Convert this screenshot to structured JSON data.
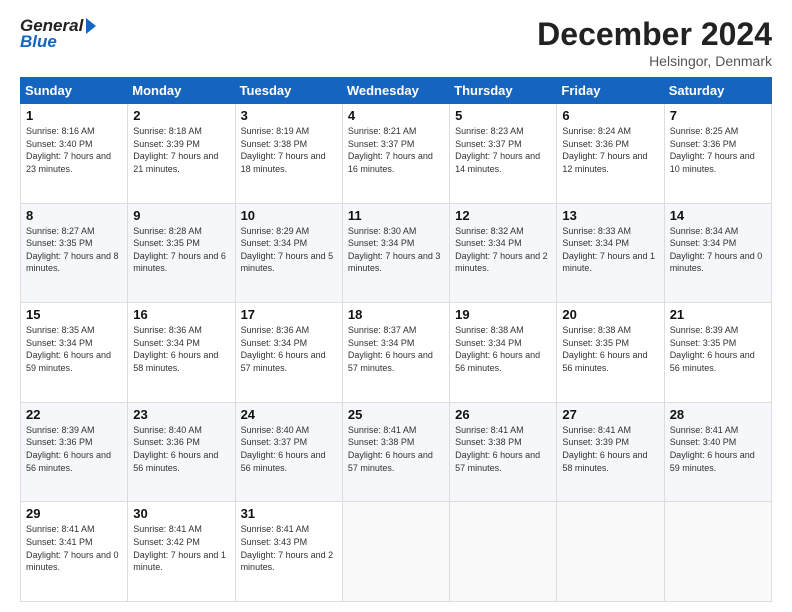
{
  "header": {
    "logo_general": "General",
    "logo_blue": "Blue",
    "month_title": "December 2024",
    "location": "Helsingor, Denmark"
  },
  "days_of_week": [
    "Sunday",
    "Monday",
    "Tuesday",
    "Wednesday",
    "Thursday",
    "Friday",
    "Saturday"
  ],
  "weeks": [
    [
      {
        "day": "1",
        "sunrise": "Sunrise: 8:16 AM",
        "sunset": "Sunset: 3:40 PM",
        "daylight": "Daylight: 7 hours and 23 minutes."
      },
      {
        "day": "2",
        "sunrise": "Sunrise: 8:18 AM",
        "sunset": "Sunset: 3:39 PM",
        "daylight": "Daylight: 7 hours and 21 minutes."
      },
      {
        "day": "3",
        "sunrise": "Sunrise: 8:19 AM",
        "sunset": "Sunset: 3:38 PM",
        "daylight": "Daylight: 7 hours and 18 minutes."
      },
      {
        "day": "4",
        "sunrise": "Sunrise: 8:21 AM",
        "sunset": "Sunset: 3:37 PM",
        "daylight": "Daylight: 7 hours and 16 minutes."
      },
      {
        "day": "5",
        "sunrise": "Sunrise: 8:23 AM",
        "sunset": "Sunset: 3:37 PM",
        "daylight": "Daylight: 7 hours and 14 minutes."
      },
      {
        "day": "6",
        "sunrise": "Sunrise: 8:24 AM",
        "sunset": "Sunset: 3:36 PM",
        "daylight": "Daylight: 7 hours and 12 minutes."
      },
      {
        "day": "7",
        "sunrise": "Sunrise: 8:25 AM",
        "sunset": "Sunset: 3:36 PM",
        "daylight": "Daylight: 7 hours and 10 minutes."
      }
    ],
    [
      {
        "day": "8",
        "sunrise": "Sunrise: 8:27 AM",
        "sunset": "Sunset: 3:35 PM",
        "daylight": "Daylight: 7 hours and 8 minutes."
      },
      {
        "day": "9",
        "sunrise": "Sunrise: 8:28 AM",
        "sunset": "Sunset: 3:35 PM",
        "daylight": "Daylight: 7 hours and 6 minutes."
      },
      {
        "day": "10",
        "sunrise": "Sunrise: 8:29 AM",
        "sunset": "Sunset: 3:34 PM",
        "daylight": "Daylight: 7 hours and 5 minutes."
      },
      {
        "day": "11",
        "sunrise": "Sunrise: 8:30 AM",
        "sunset": "Sunset: 3:34 PM",
        "daylight": "Daylight: 7 hours and 3 minutes."
      },
      {
        "day": "12",
        "sunrise": "Sunrise: 8:32 AM",
        "sunset": "Sunset: 3:34 PM",
        "daylight": "Daylight: 7 hours and 2 minutes."
      },
      {
        "day": "13",
        "sunrise": "Sunrise: 8:33 AM",
        "sunset": "Sunset: 3:34 PM",
        "daylight": "Daylight: 7 hours and 1 minute."
      },
      {
        "day": "14",
        "sunrise": "Sunrise: 8:34 AM",
        "sunset": "Sunset: 3:34 PM",
        "daylight": "Daylight: 7 hours and 0 minutes."
      }
    ],
    [
      {
        "day": "15",
        "sunrise": "Sunrise: 8:35 AM",
        "sunset": "Sunset: 3:34 PM",
        "daylight": "Daylight: 6 hours and 59 minutes."
      },
      {
        "day": "16",
        "sunrise": "Sunrise: 8:36 AM",
        "sunset": "Sunset: 3:34 PM",
        "daylight": "Daylight: 6 hours and 58 minutes."
      },
      {
        "day": "17",
        "sunrise": "Sunrise: 8:36 AM",
        "sunset": "Sunset: 3:34 PM",
        "daylight": "Daylight: 6 hours and 57 minutes."
      },
      {
        "day": "18",
        "sunrise": "Sunrise: 8:37 AM",
        "sunset": "Sunset: 3:34 PM",
        "daylight": "Daylight: 6 hours and 57 minutes."
      },
      {
        "day": "19",
        "sunrise": "Sunrise: 8:38 AM",
        "sunset": "Sunset: 3:34 PM",
        "daylight": "Daylight: 6 hours and 56 minutes."
      },
      {
        "day": "20",
        "sunrise": "Sunrise: 8:38 AM",
        "sunset": "Sunset: 3:35 PM",
        "daylight": "Daylight: 6 hours and 56 minutes."
      },
      {
        "day": "21",
        "sunrise": "Sunrise: 8:39 AM",
        "sunset": "Sunset: 3:35 PM",
        "daylight": "Daylight: 6 hours and 56 minutes."
      }
    ],
    [
      {
        "day": "22",
        "sunrise": "Sunrise: 8:39 AM",
        "sunset": "Sunset: 3:36 PM",
        "daylight": "Daylight: 6 hours and 56 minutes."
      },
      {
        "day": "23",
        "sunrise": "Sunrise: 8:40 AM",
        "sunset": "Sunset: 3:36 PM",
        "daylight": "Daylight: 6 hours and 56 minutes."
      },
      {
        "day": "24",
        "sunrise": "Sunrise: 8:40 AM",
        "sunset": "Sunset: 3:37 PM",
        "daylight": "Daylight: 6 hours and 56 minutes."
      },
      {
        "day": "25",
        "sunrise": "Sunrise: 8:41 AM",
        "sunset": "Sunset: 3:38 PM",
        "daylight": "Daylight: 6 hours and 57 minutes."
      },
      {
        "day": "26",
        "sunrise": "Sunrise: 8:41 AM",
        "sunset": "Sunset: 3:38 PM",
        "daylight": "Daylight: 6 hours and 57 minutes."
      },
      {
        "day": "27",
        "sunrise": "Sunrise: 8:41 AM",
        "sunset": "Sunset: 3:39 PM",
        "daylight": "Daylight: 6 hours and 58 minutes."
      },
      {
        "day": "28",
        "sunrise": "Sunrise: 8:41 AM",
        "sunset": "Sunset: 3:40 PM",
        "daylight": "Daylight: 6 hours and 59 minutes."
      }
    ],
    [
      {
        "day": "29",
        "sunrise": "Sunrise: 8:41 AM",
        "sunset": "Sunset: 3:41 PM",
        "daylight": "Daylight: 7 hours and 0 minutes."
      },
      {
        "day": "30",
        "sunrise": "Sunrise: 8:41 AM",
        "sunset": "Sunset: 3:42 PM",
        "daylight": "Daylight: 7 hours and 1 minute."
      },
      {
        "day": "31",
        "sunrise": "Sunrise: 8:41 AM",
        "sunset": "Sunset: 3:43 PM",
        "daylight": "Daylight: 7 hours and 2 minutes."
      },
      null,
      null,
      null,
      null
    ]
  ]
}
